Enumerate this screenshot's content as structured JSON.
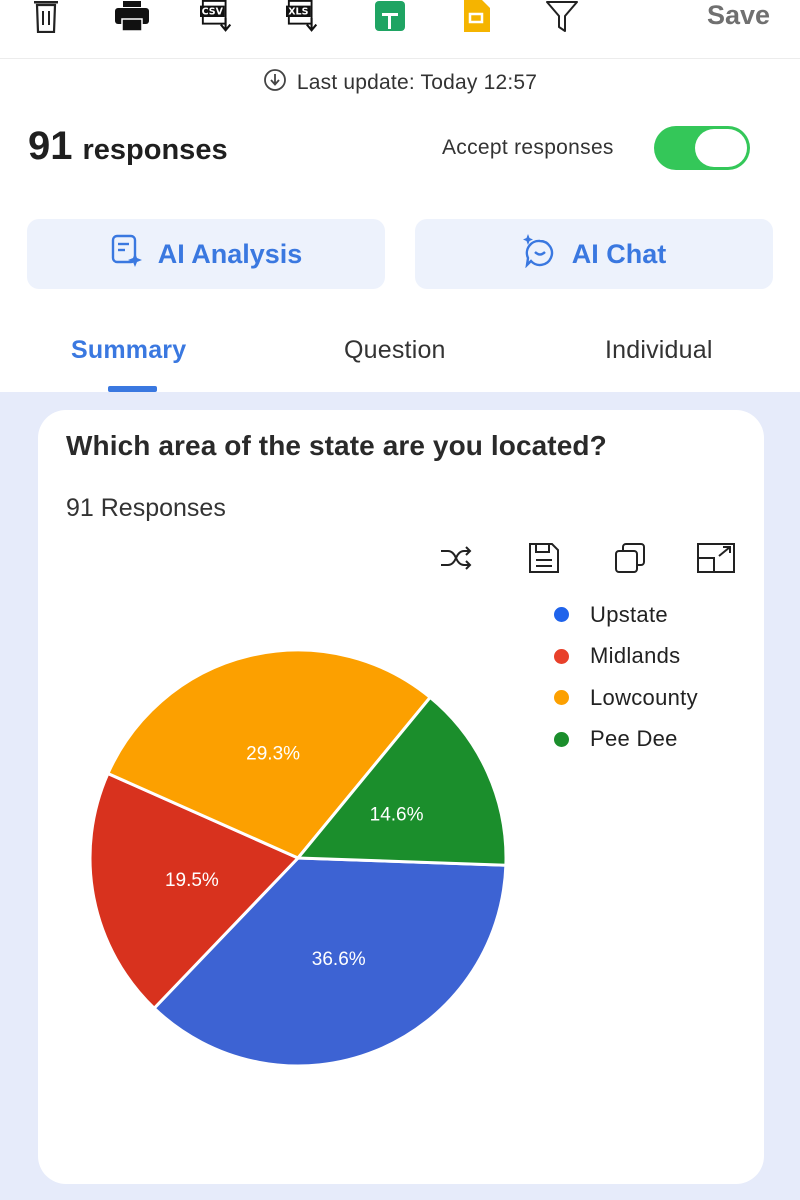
{
  "toolbar": {
    "icons": [
      "trash-icon",
      "print-icon",
      "csv-export-icon",
      "xls-export-icon",
      "google-sheets-icon",
      "google-slides-icon",
      "filter-icon"
    ],
    "csv_label": "CSV",
    "xls_label": "XLS",
    "save_label": "Save"
  },
  "status": {
    "last_update": "Last update: Today 12:57"
  },
  "responses": {
    "count": "91",
    "label": "responses",
    "accept_label": "Accept responses",
    "accepting": true
  },
  "ai": {
    "analysis_label": "AI Analysis",
    "chat_label": "AI Chat"
  },
  "tabs": [
    {
      "label": "Summary",
      "active": true
    },
    {
      "label": "Question",
      "active": false
    },
    {
      "label": "Individual",
      "active": false
    }
  ],
  "colors": {
    "accent": "#3a78e0",
    "toggle_on": "#34c759",
    "upstate": "#3d63d3",
    "midlands": "#d8321e",
    "lowcounty": "#fca000",
    "pee_dee": "#1b8e2c"
  },
  "question": {
    "title": "Which area of the state are you located?",
    "count_label": "91 Responses",
    "chart_tools": [
      "shuffle-icon",
      "save-icon",
      "copy-icon",
      "expand-icon"
    ]
  },
  "chart_data": {
    "type": "pie",
    "slices": [
      {
        "label": "Upstate",
        "value": 36.6,
        "display": "36.6%",
        "color": "#3d63d3"
      },
      {
        "label": "Midlands",
        "value": 19.5,
        "display": "19.5%",
        "color": "#d8321e"
      },
      {
        "label": "Lowcounty",
        "value": 29.3,
        "display": "29.3%",
        "color": "#fca000"
      },
      {
        "label": "Pee Dee",
        "value": 14.6,
        "display": "14.6%",
        "color": "#1b8e2c"
      }
    ],
    "legend_position": "right"
  }
}
